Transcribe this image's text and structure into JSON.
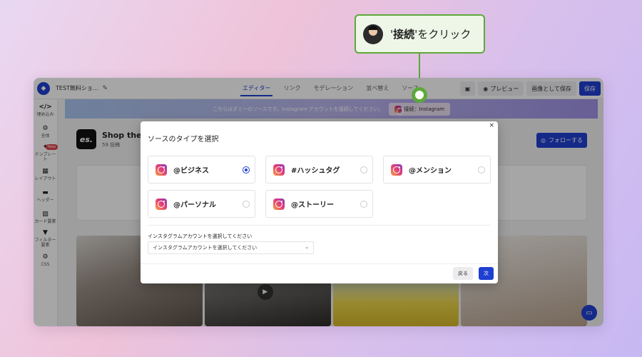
{
  "callout": {
    "prefix": "'",
    "bold_text": "接続",
    "suffix": "'をクリック",
    "accent_color": "#5da83a"
  },
  "app": {
    "title": "TEST無料ショ...",
    "tabs": [
      "エディター",
      "リンク",
      "モデレーション",
      "並べ替え",
      "ソース"
    ],
    "active_tab": "エディター",
    "toolbar": {
      "preview": "プレビュー",
      "save_as_image": "画像として保存",
      "save": "保存"
    },
    "sidebar": [
      {
        "icon": "</>",
        "label": "埋め込み"
      },
      {
        "icon": "gear-icon",
        "label": "全体"
      },
      {
        "icon": "template-icon",
        "label": "テンプレート",
        "badge": "New"
      },
      {
        "icon": "layout-icon",
        "label": "レイアウト"
      },
      {
        "icon": "header-icon",
        "label": "ヘッダー"
      },
      {
        "icon": "image-icon",
        "label": "カード要素"
      },
      {
        "icon": "filter-icon",
        "label": "フィルター要素"
      },
      {
        "icon": "gear-icon",
        "label": "CSS"
      }
    ],
    "banner": {
      "text": "こちらはダミーのソースです。Instagram アカウントを接続してください。",
      "button": "接続：Instagram"
    },
    "profile": {
      "logo": "es.",
      "name": "Shop the lo",
      "posts": "59 投稿",
      "follow": "フォローする"
    },
    "brand_color": "#1f3fd1"
  },
  "modal": {
    "title": "ソースのタイプを選択",
    "close": "×",
    "options": [
      {
        "label": "@ビジネス",
        "selected": true
      },
      {
        "label": "#ハッシュタグ",
        "selected": false
      },
      {
        "label": "@メンション",
        "selected": false
      },
      {
        "label": "@パーソナル",
        "selected": false
      },
      {
        "label": "@ストーリー",
        "selected": false
      }
    ],
    "account_label": "インスタグラムアカウントを選択してください",
    "account_placeholder": "インスタグラムアカウントを選択してください",
    "back": "戻る",
    "next": "次"
  }
}
